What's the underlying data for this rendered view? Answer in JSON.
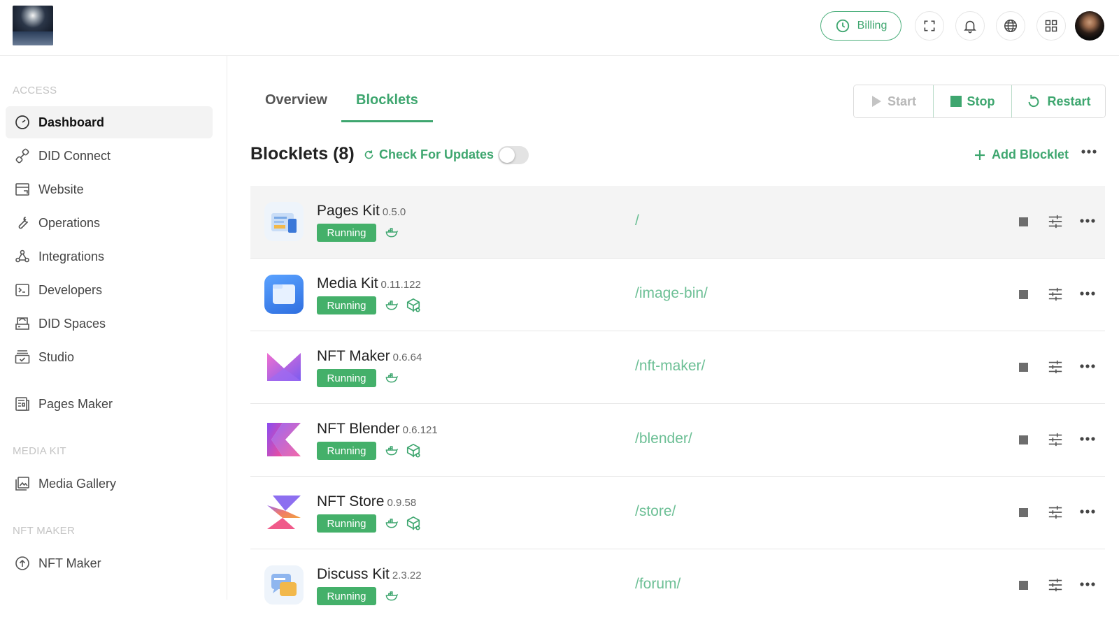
{
  "header": {
    "billing_label": "Billing",
    "icons": [
      "fullscreen-icon",
      "bell-icon",
      "globe-icon",
      "apps-grid-icon"
    ]
  },
  "sidebar": {
    "sections": [
      {
        "title": "ACCESS"
      },
      {
        "title": "MEDIA KIT"
      },
      {
        "title": "NFT MAKER"
      }
    ],
    "items": [
      {
        "label": "Dashboard",
        "icon": "dashboard-gauge-icon",
        "active": true
      },
      {
        "label": "DID Connect",
        "icon": "link-icon"
      },
      {
        "label": "Website",
        "icon": "browser-icon"
      },
      {
        "label": "Operations",
        "icon": "wrench-icon"
      },
      {
        "label": "Integrations",
        "icon": "webhook-icon"
      },
      {
        "label": "Developers",
        "icon": "terminal-icon"
      },
      {
        "label": "DID Spaces",
        "icon": "storage-icon"
      },
      {
        "label": "Studio",
        "icon": "studio-icon"
      },
      {
        "label": "Pages Maker",
        "icon": "pages-icon"
      },
      {
        "label": "Media Gallery",
        "icon": "gallery-icon"
      },
      {
        "label": "NFT Maker",
        "icon": "arrow-up-circle-icon"
      }
    ]
  },
  "tabs": [
    {
      "label": "Overview",
      "active": false
    },
    {
      "label": "Blocklets",
      "active": true
    }
  ],
  "controls": {
    "start": "Start",
    "stop": "Stop",
    "restart": "Restart"
  },
  "blocklets": {
    "title": "Blocklets (8)",
    "check_updates": "Check For Updates",
    "add_label": "Add Blocklet",
    "rows": [
      {
        "name": "Pages Kit",
        "version": "0.5.0",
        "status": "Running",
        "path": "/"
      },
      {
        "name": "Media Kit",
        "version": "0.11.122",
        "status": "Running",
        "path": "/image-bin/"
      },
      {
        "name": "NFT Maker",
        "version": "0.6.64",
        "status": "Running",
        "path": "/nft-maker/"
      },
      {
        "name": "NFT Blender",
        "version": "0.6.121",
        "status": "Running",
        "path": "/blender/"
      },
      {
        "name": "NFT Store",
        "version": "0.9.58",
        "status": "Running",
        "path": "/store/"
      },
      {
        "name": "Discuss Kit",
        "version": "2.3.22",
        "status": "Running",
        "path": "/forum/"
      }
    ]
  },
  "colors": {
    "accent": "#3ea66f",
    "running_badge": "#44b06a",
    "path": "#6cbf95"
  }
}
